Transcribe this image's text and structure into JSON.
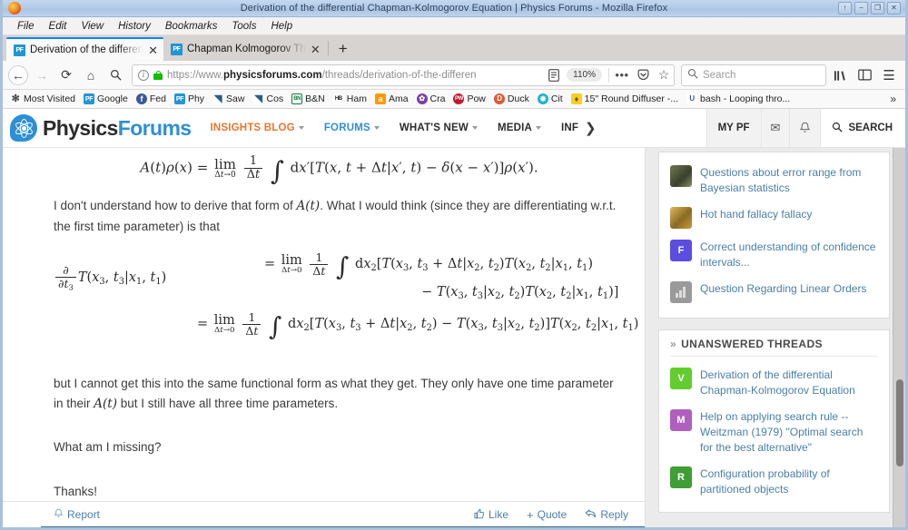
{
  "window": {
    "title": "Derivation of the differential Chapman-Kolmogorov Equation | Physics Forums - Mozilla Firefox",
    "buttons": {
      "restore_up": "↑",
      "minimize": "−",
      "maximize": "❐",
      "close": "✕"
    }
  },
  "menubar": {
    "items": [
      "File",
      "Edit",
      "View",
      "History",
      "Bookmarks",
      "Tools",
      "Help"
    ]
  },
  "tabs": [
    {
      "favicon_label": "PF",
      "title": "Derivation of the differen",
      "close": "✕",
      "active": true
    },
    {
      "favicon_label": "PF",
      "title": "Chapman Kolmogorov Th",
      "close": "✕",
      "active": false
    }
  ],
  "newtab_label": "+",
  "toolbar": {
    "back": "←",
    "forward": "→",
    "reload": "⟳",
    "home": "⌂",
    "search_toolbar_icon": "search-icon",
    "url_scheme": "https://www.",
    "url_domain": "physicsforums.com",
    "url_path": "/threads/derivation-of-the-differen",
    "reader_icon": "reader-view-icon",
    "zoom_level": "110%",
    "page_actions": "•••",
    "pocket_icon": "pocket-icon",
    "bookmark_star": "☆",
    "search_placeholder": "Search",
    "library_icon": "library-icon",
    "sidebar_icon": "sidebar-icon",
    "menu_icon": "☰"
  },
  "bookmarks": {
    "items": [
      {
        "label": "Most Visited",
        "icon": "star-icon",
        "icon_text": "✻",
        "color": "#ffffff",
        "fg": "#444444"
      },
      {
        "label": "Google",
        "icon": "pf-icon",
        "icon_text": "PF",
        "color": "#2196d6",
        "fg": "#ffffff"
      },
      {
        "label": "Fed",
        "icon": "facebook-icon",
        "icon_text": "f",
        "color": "#3b5998",
        "fg": "#ffffff"
      },
      {
        "label": "Phy",
        "icon": "pf-icon",
        "icon_text": "PF",
        "color": "#2196d6",
        "fg": "#ffffff"
      },
      {
        "label": "Saw",
        "icon": "blade-icon",
        "icon_text": "◥",
        "color": "#ffffff",
        "fg": "#2b5c84"
      },
      {
        "label": "Cos",
        "icon": "blade-icon",
        "icon_text": "◥",
        "color": "#ffffff",
        "fg": "#2b5c84"
      },
      {
        "label": "B&N",
        "icon": "barnes-icon",
        "icon_text": "BN",
        "color": "#ffffff",
        "fg": "#0a7b3e"
      },
      {
        "label": "Ham",
        "icon": "hb-icon",
        "icon_text": "HB",
        "color": "#ffffff",
        "fg": "#1a1a1a"
      },
      {
        "label": "Ama",
        "icon": "amazon-icon",
        "icon_text": "a",
        "color": "#ff9900",
        "fg": "#ffffff"
      },
      {
        "label": "Cra",
        "icon": "craigslist-icon",
        "icon_text": "✿",
        "color": "#7b3fa0",
        "fg": "#ffffff"
      },
      {
        "label": "Pow",
        "icon": "powells-icon",
        "icon_text": "P",
        "color": "#c0182b",
        "fg": "#ffffff"
      },
      {
        "label": "Duck",
        "icon": "duckduckgo-icon",
        "icon_text": "D",
        "color": "#de5833",
        "fg": "#ffffff"
      },
      {
        "label": "Cit",
        "icon": "globe-icon",
        "icon_text": "✸",
        "color": "#1ab3d0",
        "fg": "#ffffff"
      },
      {
        "label": "15\" Round Diffuser -...",
        "icon": "bulb-icon",
        "icon_text": "♦",
        "color": "#f5d020",
        "fg": "#6a5400"
      },
      {
        "label": "bash - Looping thro...",
        "icon": "stackexchange-icon",
        "icon_text": "U",
        "color": "#ffffff",
        "fg": "#3b5ca8"
      }
    ],
    "overflow": "»"
  },
  "site": {
    "logo": {
      "word1": "Physics",
      "word2": "Forums",
      "icon": "atom-speech-bubble-icon"
    },
    "nav": [
      {
        "label": "INSIGHTS BLOG",
        "has_caret": true,
        "style": "insights"
      },
      {
        "label": "FORUMS",
        "has_caret": true,
        "style": "forums"
      },
      {
        "label": "WHAT'S NEW",
        "has_caret": true,
        "style": ""
      },
      {
        "label": "MEDIA",
        "has_caret": true,
        "style": ""
      },
      {
        "label": "INF",
        "has_caret": false,
        "style": ""
      }
    ],
    "nav_overflow": "❯",
    "my_pf": "MY PF",
    "inbox_icon": "✉",
    "alerts_icon": "🔔",
    "search_label": "SEARCH",
    "search_icon": "search-icon"
  },
  "post": {
    "equation_top": {
      "lhs": "A(t)ρ(x)  =",
      "lim": "lim",
      "lim_sub": "Δt→0",
      "frac_num": "1",
      "frac_den": "Δt",
      "integral": "∫",
      "body": "dx′[T(x, t + Δt|x′, t) − δ(x − x′)]ρ(x′)."
    },
    "para1_a": "I don't understand how to derive that form of ",
    "para1_math": "A(t)",
    "para1_b": ". What I would think (since they are differentiating w.r.t. the first time parameter) is that",
    "equation_main": {
      "lhs_partial_num": "∂",
      "lhs_partial_den": "∂t",
      "lhs_partial_den_sub": "3",
      "lhs_rest": "T(x3, t3|x1, t1)",
      "line1": "= lim Δt→0  1/Δt  ∫ dx2[T(x3, t3 + Δt|x2, t2)T(x2, t2|x1, t1)",
      "line2": "− T(x3, t3|x2, t2)T(x2, t2|x1, t1)]",
      "line3": "= lim Δt→0  1/Δt  ∫ dx2[T(x3, t3 + Δt|x2, t2) − T(x3, t3|x2, t2)]T(x2, t2|x1, t1)"
    },
    "para2_a": "but I cannot get this into the same functional form as what they get. They only have one time parameter in their ",
    "para2_math": "A(t)",
    "para2_b": " but I still have all three time parameters.",
    "para3": "What am I missing?",
    "para4": "Thanks!",
    "actions": {
      "report": "Report",
      "report_icon": "bell-icon",
      "like": "Like",
      "like_icon": "thumbs-up-icon",
      "quote": "Quote",
      "quote_icon": "plus-icon",
      "reply": "Reply",
      "reply_icon": "reply-arrow-icon"
    }
  },
  "sidebar": {
    "widget_top": {
      "threads": [
        {
          "title": "Questions about error range from Bayesian statistics",
          "avatar_label": "",
          "avatar_color": "#6b7059",
          "avatar_kind": "photo"
        },
        {
          "title": "Hot hand fallacy fallacy",
          "avatar_label": "",
          "avatar_color": "#c99a3e",
          "avatar_kind": "photo"
        },
        {
          "title": "Correct understanding of confidence intervals...",
          "avatar_label": "F",
          "avatar_color": "#5b4de0",
          "avatar_kind": "letter"
        },
        {
          "title": "Question Regarding Linear Orders",
          "avatar_label": "",
          "avatar_color": "#8d8d8d",
          "avatar_kind": "chart"
        }
      ]
    },
    "widget_unanswered": {
      "chevron": "»",
      "title": "UNANSWERED THREADS",
      "threads": [
        {
          "title": "Derivation of the differential Chapman-Kolmogorov Equation",
          "avatar_label": "V",
          "avatar_color": "#63cc2e",
          "avatar_kind": "letter"
        },
        {
          "title": "Help on applying search rule -- Weitzman (1979) \"Optimal search for the best alternative\"",
          "avatar_label": "M",
          "avatar_color": "#b05fbe",
          "avatar_kind": "letter"
        },
        {
          "title": "Configuration probability of partitioned objects",
          "avatar_label": "R",
          "avatar_color": "#3f9e34",
          "avatar_kind": "letter"
        }
      ]
    }
  },
  "colors": {
    "accent_blue": "#2f8fd4",
    "insights_orange": "#e8762c",
    "link_blue": "#4a7fa8",
    "tab_active_border": "#0a84ff"
  }
}
